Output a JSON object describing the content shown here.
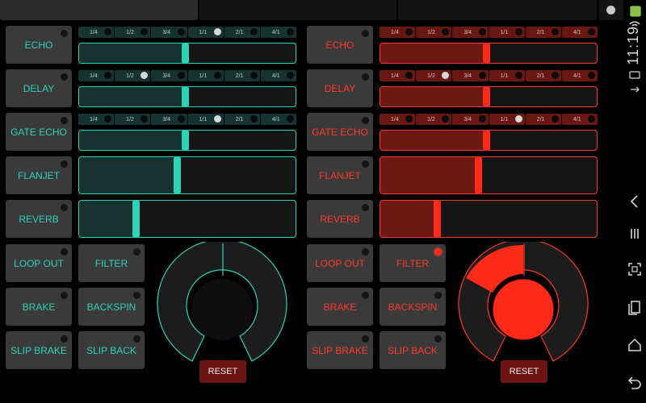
{
  "colors": {
    "left_accent": "#2ed3b7",
    "right_accent": "#ff3a2a",
    "button_bg": "#3a3a3a",
    "reset_bg": "#6b1411"
  },
  "beat_divisions": [
    "1/4",
    "1/2",
    "3/4",
    "1/1",
    "2/1",
    "4/1"
  ],
  "left": {
    "effects": [
      {
        "label": "ECHO",
        "beat_on": 3,
        "level": 0.49
      },
      {
        "label": "DELAY",
        "beat_on": 1,
        "level": 0.49
      },
      {
        "label": "GATE ECHO",
        "beat_on": 3,
        "level": 0.49
      },
      {
        "label": "FLANJET",
        "level": 0.45
      },
      {
        "label": "REVERB",
        "level": 0.26
      }
    ],
    "buttons": [
      "LOOP OUT",
      "FILTER",
      "BRAKE",
      "BACKSPIN",
      "SLIP BRAKE",
      "SLIP BACK"
    ],
    "reset_label": "RESET"
  },
  "right": {
    "effects": [
      {
        "label": "ECHO",
        "beat_on": -1,
        "level": 0.49
      },
      {
        "label": "DELAY",
        "beat_on": 1,
        "level": 0.49
      },
      {
        "label": "GATE ECHO",
        "beat_on": 3,
        "level": 0.49
      },
      {
        "label": "FLANJET",
        "level": 0.45
      },
      {
        "label": "REVERB",
        "level": 0.26
      }
    ],
    "buttons": [
      "LOOP OUT",
      "FILTER",
      "BRAKE",
      "BACKSPIN",
      "SLIP BRAKE",
      "SLIP BACK"
    ],
    "filter_active": true,
    "reset_label": "RESET"
  },
  "status": {
    "time": "11:19"
  },
  "icons": [
    "android-icon",
    "wifi-icon",
    "battery-icon",
    "usb-icon",
    "back-icon",
    "menu-icon",
    "screenshot-icon",
    "recent-apps-icon",
    "home-icon",
    "undo-icon"
  ]
}
